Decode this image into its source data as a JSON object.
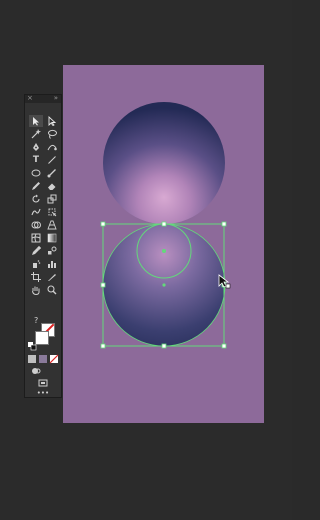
{
  "app": {
    "toolbar_close": "×",
    "toolbar_grip": "»",
    "help_glyph": "?",
    "more_tools_glyph": "•••"
  },
  "colors": {
    "workspace": "#2b2b2b",
    "artboard": "#8d6a9a",
    "sphere_dark": "#232a55",
    "sphere_light": "#c79fc8",
    "selection": "#63d97b"
  },
  "tools": [
    {
      "name": "selection-tool-icon"
    },
    {
      "name": "direct-selection-tool-icon"
    },
    {
      "name": "magic-wand-tool-icon"
    },
    {
      "name": "lasso-tool-icon"
    },
    {
      "name": "pen-tool-icon"
    },
    {
      "name": "curvature-tool-icon"
    },
    {
      "name": "type-tool-icon"
    },
    {
      "name": "line-tool-icon"
    },
    {
      "name": "ellipse-tool-icon"
    },
    {
      "name": "paintbrush-tool-icon"
    },
    {
      "name": "pencil-tool-icon"
    },
    {
      "name": "eraser-tool-icon"
    },
    {
      "name": "rotate-tool-icon"
    },
    {
      "name": "scale-tool-icon"
    },
    {
      "name": "warp-tool-icon"
    },
    {
      "name": "free-transform-tool-icon"
    },
    {
      "name": "shape-builder-tool-icon"
    },
    {
      "name": "perspective-grid-tool-icon"
    },
    {
      "name": "mesh-tool-icon"
    },
    {
      "name": "gradient-tool-icon"
    },
    {
      "name": "eyedropper-tool-icon"
    },
    {
      "name": "blend-tool-icon"
    },
    {
      "name": "symbol-sprayer-tool-icon"
    },
    {
      "name": "column-graph-tool-icon"
    },
    {
      "name": "artboard-tool-icon"
    },
    {
      "name": "slice-tool-icon"
    },
    {
      "name": "hand-tool-icon"
    },
    {
      "name": "zoom-tool-icon"
    }
  ]
}
